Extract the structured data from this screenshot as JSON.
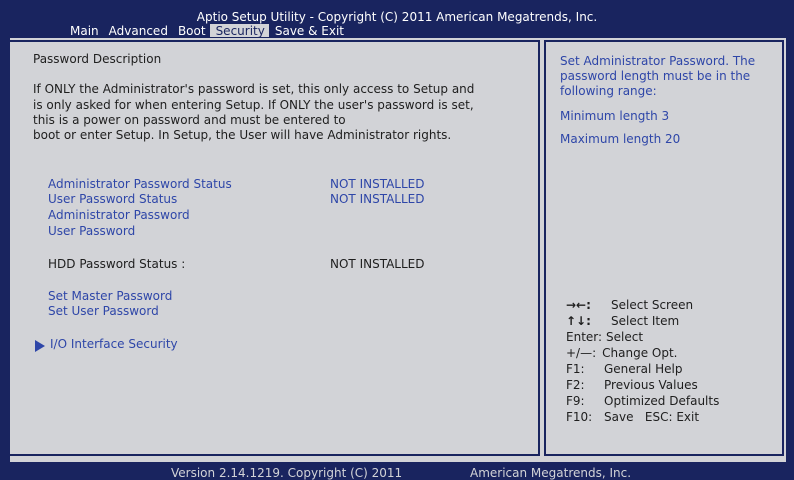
{
  "header": {
    "title": "Aptio Setup Utility - Copyright (C) 2011 American Megatrends, Inc."
  },
  "menu": {
    "tabs": [
      {
        "label": "Main"
      },
      {
        "label": "Advanced"
      },
      {
        "label": "Boot"
      },
      {
        "label": "Security"
      },
      {
        "label": "Save & Exit"
      }
    ],
    "active": "Security"
  },
  "left": {
    "section_title": "Password Description",
    "description": [
      "If ONLY the Administrator's password is set, this only access to Setup and",
      "is only asked for when entering Setup. If ONLY the user's password is set,",
      "this is a power on password and must be entered to",
      "boot or enter Setup. In Setup, the User will have Administrator rights."
    ],
    "items": {
      "admin_status_label": "Administrator Password Status",
      "admin_status_value": "NOT INSTALLED",
      "user_status_label": "User Password Status",
      "user_status_value": "NOT INSTALLED",
      "admin_password": "Administrator Password",
      "user_password": "User Password",
      "hdd_status_label": "HDD Password Status :",
      "hdd_status_value": "NOT INSTALLED",
      "set_master": "Set Master Password",
      "set_user": "Set User Password",
      "io_security": "I/O Interface Security"
    }
  },
  "right": {
    "help_lines": [
      "Set Administrator Password. The",
      "password length must be in the",
      "following range:"
    ],
    "min_length": "Minimum length  3",
    "max_length": "Maximum length 20",
    "keys": [
      {
        "key": "→←:",
        "desc": "Select Screen"
      },
      {
        "key": "↑↓:",
        "desc": "Select Item"
      },
      {
        "key": "Enter:",
        "desc": "Select"
      },
      {
        "key": "+/—:",
        "desc": "Change Opt."
      },
      {
        "key": "F1:",
        "desc": "General Help"
      },
      {
        "key": "F2:",
        "desc": "Previous Values"
      },
      {
        "key": "F9:",
        "desc": "Optimized Defaults"
      },
      {
        "key": "F10:",
        "desc": "Save   ESC: Exit"
      }
    ]
  },
  "footer": {
    "version": "Version 2.14.1219. Copyright (C) 2011",
    "vendor": "American Megatrends, Inc."
  }
}
